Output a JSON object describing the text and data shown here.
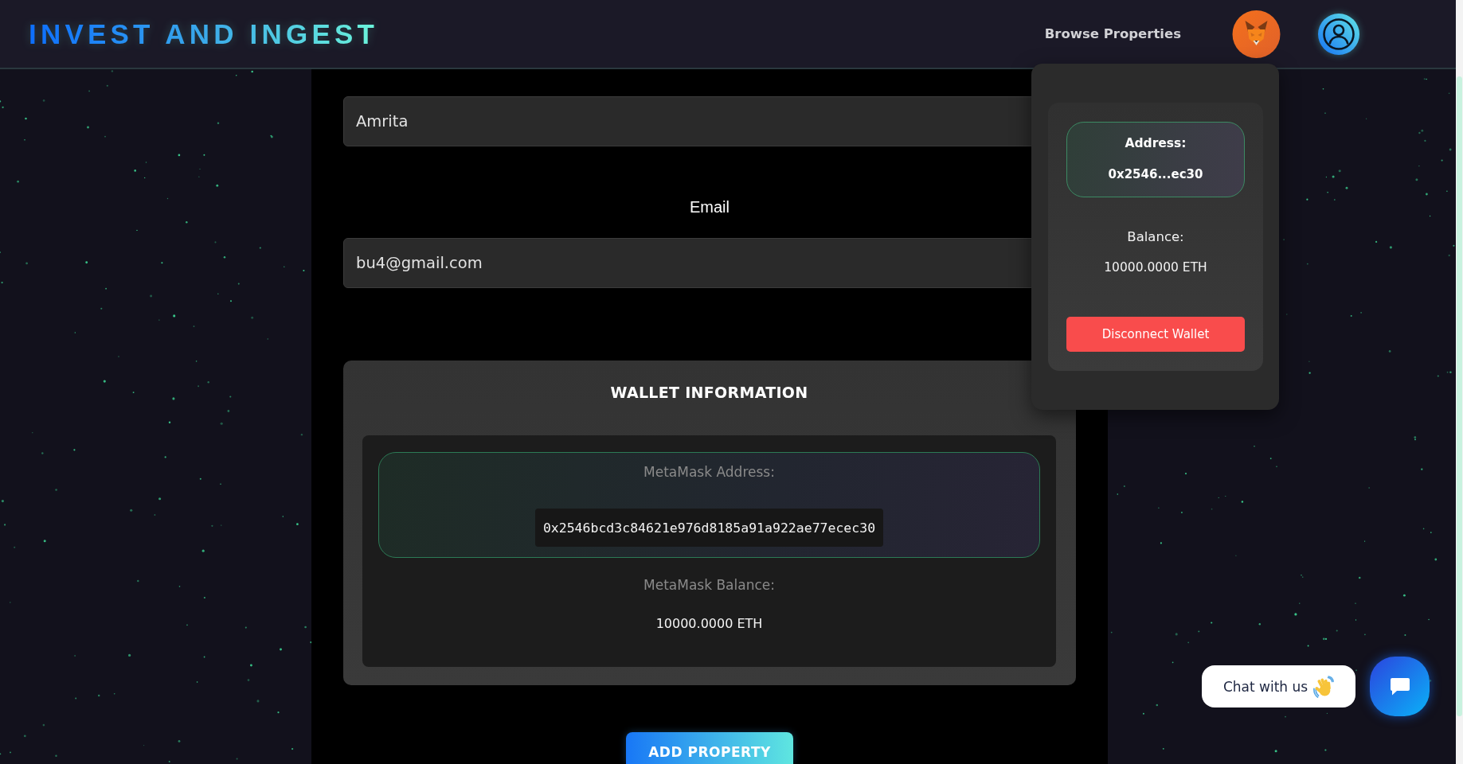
{
  "header": {
    "logo": "INVEST AND INGEST",
    "nav_link": "Browse Properties"
  },
  "wallet_dropdown": {
    "address_label": "Address:",
    "address": "0x2546...ec30",
    "balance_label": "Balance:",
    "balance": "10000.0000 ETH",
    "disconnect_button": "Disconnect Wallet"
  },
  "form": {
    "fields": [
      {
        "value": "Amrita"
      },
      {
        "label": "Email",
        "value": "bu4@gmail.com"
      }
    ]
  },
  "wallet_info": {
    "title": "WALLET INFORMATION",
    "address_label": "MetaMask Address:",
    "address": "0x2546bcd3c84621e976d8185a91a922ae77ecec30",
    "balance_label": "MetaMask Balance:",
    "balance": "10000.0000 ETH"
  },
  "submit_button": "ADD PROPERTY",
  "chat": {
    "prompt": "Chat with us"
  }
}
